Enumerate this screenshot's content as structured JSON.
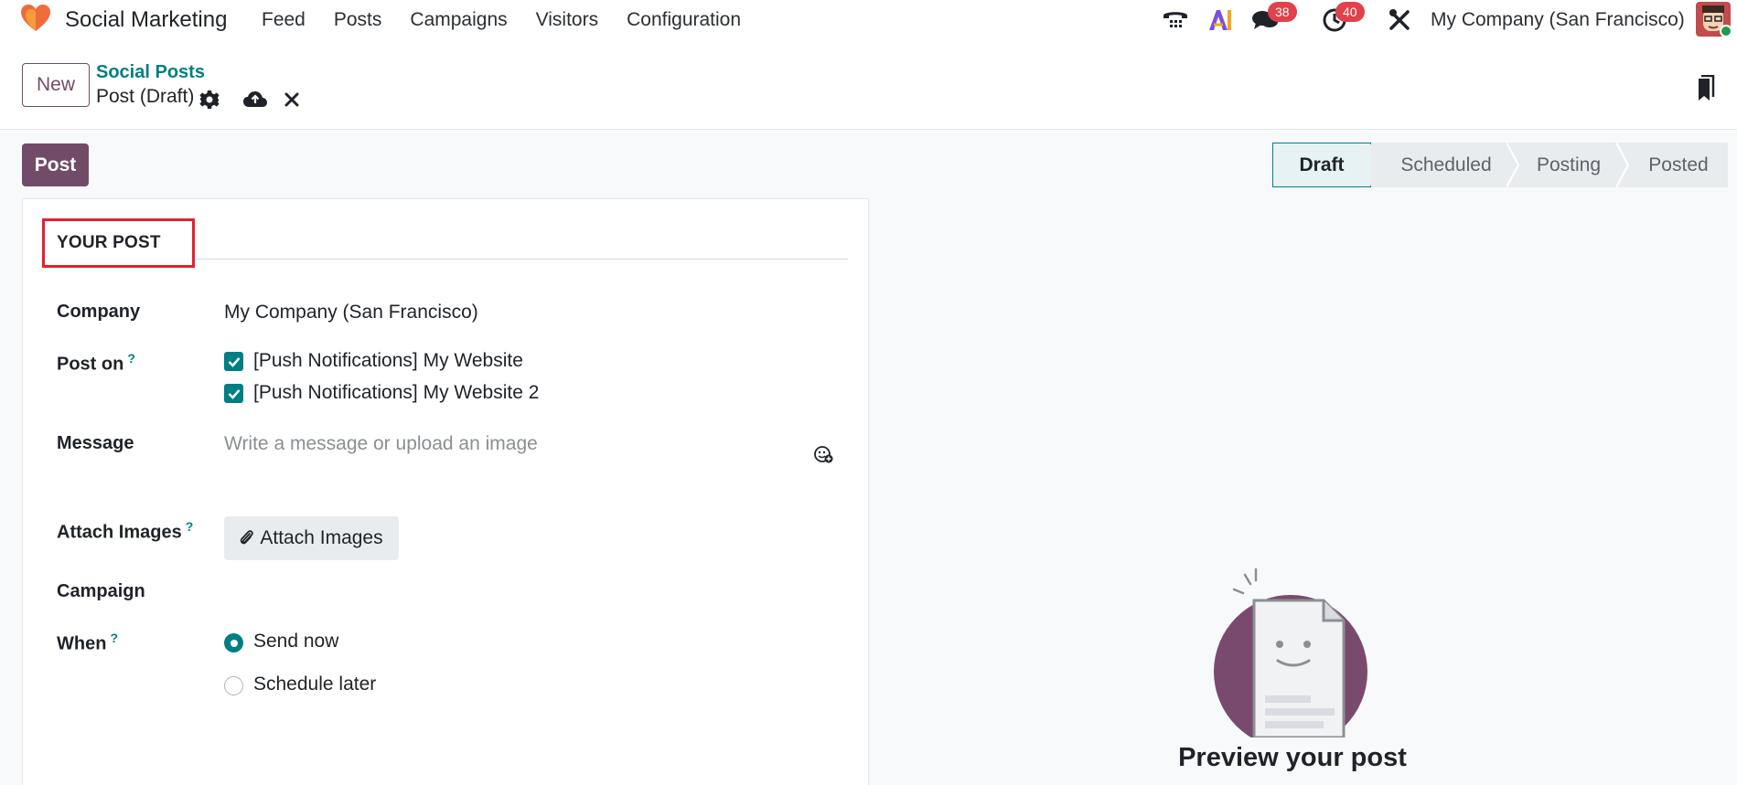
{
  "navbar": {
    "app_name": "Social Marketing",
    "menu": [
      "Feed",
      "Posts",
      "Campaigns",
      "Visitors",
      "Configuration"
    ],
    "icons": [
      "phone-icon",
      "ai-icon",
      "chat-icon",
      "activity-clock-icon",
      "debug-tools-icon"
    ],
    "messages_badge": "38",
    "activities_badge": "40",
    "company": "My Company (San Francisco)"
  },
  "control": {
    "new_label": "New",
    "breadcrumb": "Social Posts",
    "record_name": "Post (Draft)"
  },
  "actions": {
    "post_label": "Post"
  },
  "status": {
    "stages": [
      "Draft",
      "Scheduled",
      "Posting",
      "Posted"
    ],
    "active": "Draft"
  },
  "form": {
    "section_title": "YOUR POST",
    "company_label": "Company",
    "company_value": "My Company (San Francisco)",
    "post_on_label": "Post on",
    "post_on_tip": "?",
    "accounts": [
      {
        "label": "[Push Notifications] My Website",
        "checked": true
      },
      {
        "label": "[Push Notifications] My Website 2",
        "checked": true
      }
    ],
    "message_label": "Message",
    "message_placeholder": "Write a message or upload an image",
    "attach_label": "Attach Images",
    "attach_tip": "?",
    "attach_button": "Attach Images",
    "campaign_label": "Campaign",
    "when_label": "When",
    "when_tip": "?",
    "when_options": [
      {
        "label": "Send now",
        "selected": true
      },
      {
        "label": "Schedule later",
        "selected": false
      }
    ]
  },
  "preview": {
    "title": "Preview your post"
  },
  "colors": {
    "brand": "#714b67",
    "accent": "#017e84",
    "badge": "#e0414a",
    "highlight": "#e5202e"
  }
}
